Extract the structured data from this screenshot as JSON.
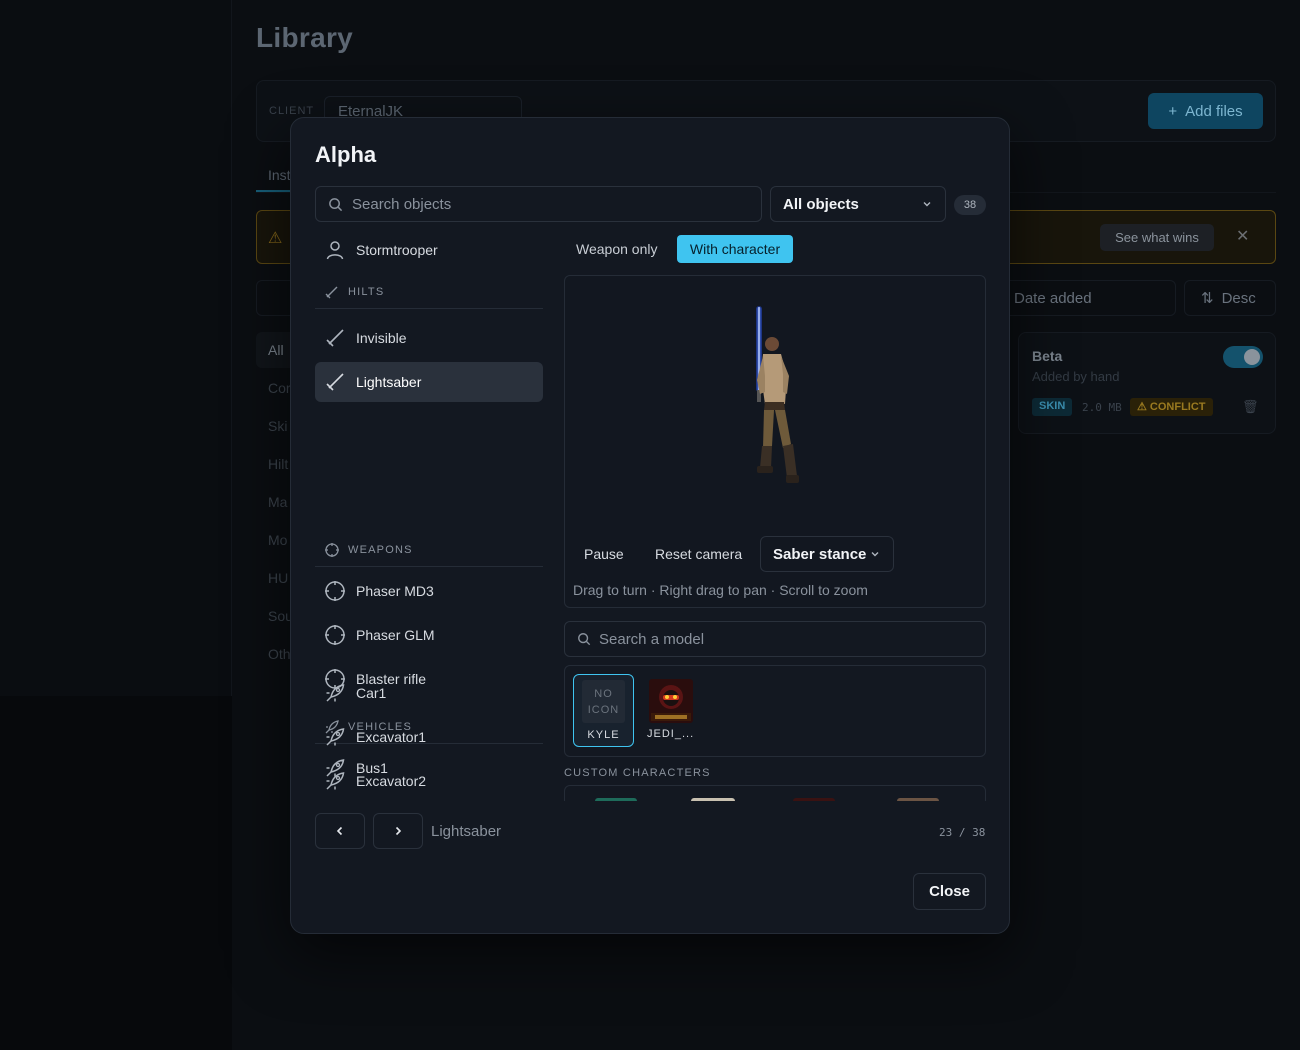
{
  "app": {
    "page_title": "Library",
    "client_label": "CLIENT",
    "client_value": "EternalJK",
    "add_files_label": "Add files",
    "tab_installed_partial": "Inst",
    "banner_action": "See what wins",
    "sort_field": "Date added",
    "sort_direction": "Desc",
    "category_all": "All",
    "categories_partial": [
      "Cor",
      "Ski",
      "Hilt",
      "Ma",
      "Mo",
      "HU",
      "Sou",
      "Oth"
    ],
    "card": {
      "name": "Beta",
      "subtitle": "Added by hand",
      "type_badge": "SKIN",
      "size": "2.0 MB",
      "conflict_badge": "CONFLICT"
    }
  },
  "modal": {
    "title": "Alpha",
    "search_placeholder": "Search objects",
    "filter_value": "All objects",
    "count": "38",
    "list": {
      "top_item": "Stormtrooper",
      "sections": [
        {
          "title": "HILTS",
          "items": [
            "Invisible",
            "Lightsaber"
          ]
        },
        {
          "title": "WEAPONS",
          "items": [
            "Phaser MD3",
            "Phaser GLM",
            "Blaster rifle"
          ]
        },
        {
          "title": "VEHICLES",
          "items": [
            "Bus1",
            "Car1",
            "Excavator1",
            "Excavator2"
          ]
        }
      ],
      "selected": "Lightsaber"
    },
    "view_mode": {
      "weapon_only": "Weapon only",
      "with_character": "With character",
      "active": "with_character"
    },
    "viewer": {
      "pause": "Pause",
      "reset_camera": "Reset camera",
      "stance": "Saber stance",
      "hint": "Drag to turn · Right drag to pan · Scroll to zoom"
    },
    "model_search_placeholder": "Search a model",
    "models": [
      {
        "name": "KYLE",
        "icon_text": "NO ICON",
        "selected": true
      },
      {
        "name": "JEDI_...",
        "icon_text": "",
        "selected": false
      }
    ],
    "custom_characters_label": "CUSTOM CHARACTERS",
    "footer": {
      "current": "Lightsaber",
      "position": "23 / 38",
      "close": "Close"
    }
  },
  "colors": {
    "accent": "#3fc4f0",
    "modal_bg": "#131821",
    "border": "#2a313c",
    "warning": "#9a7a20"
  }
}
